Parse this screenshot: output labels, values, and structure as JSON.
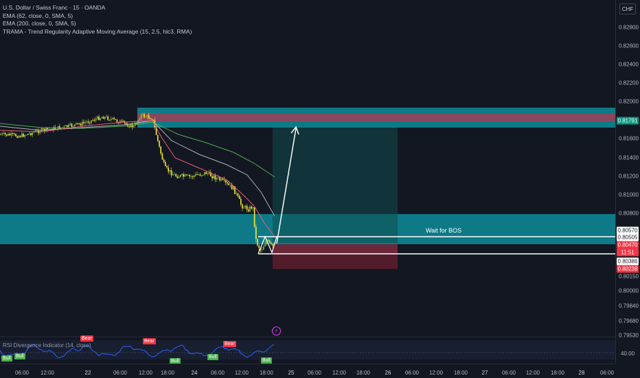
{
  "header": {
    "symbol_line": "U.S. Dollar / Swiss Franc · 15 · OANDA",
    "indicators": [
      "EMA (62, close, 0, SMA, 5)",
      "EMA (200, close, 0, SMA, 5)",
      "TRAMA - Trend Regularity Adaptive Moving Average (15, 2.5, hlc3, RMA)"
    ],
    "currency": "CHF"
  },
  "price_axis": {
    "ticks": [
      "0.82800",
      "0.82600",
      "0.82400",
      "0.82200",
      "0.82000",
      "0.81600",
      "0.81400",
      "0.81200",
      "0.81000",
      "0.80800",
      "0.80150",
      "0.80000",
      "0.79840",
      "0.79680",
      "0.79530"
    ],
    "labels": [
      {
        "text": "0.81791",
        "bg": "#089981",
        "fg": "#ffffff"
      },
      {
        "text": "0.80570",
        "bg": "#ffffff",
        "fg": "#131722"
      },
      {
        "text": "0.80505",
        "bg": "#ffffff",
        "fg": "#131722"
      },
      {
        "text": "0.80470",
        "bg": "#f23645",
        "fg": "#ffffff"
      },
      {
        "text": "11:51",
        "bg": "#f23645",
        "fg": "#ffffff"
      },
      {
        "text": "0.80386",
        "bg": "#ffffff",
        "fg": "#131722"
      },
      {
        "text": "0.80238",
        "bg": "#f23645",
        "fg": "#ffffff"
      }
    ]
  },
  "time_axis": [
    "06:00",
    "12:00",
    "22",
    "06:00",
    "12:00",
    "18:00",
    "24",
    "06:00",
    "12:00",
    "18:00",
    "25",
    "06:00",
    "12:00",
    "18:00",
    "26",
    "06:00",
    "12:00",
    "18:00",
    "27",
    "06:00",
    "12:00",
    "18:00",
    "28",
    "06:00",
    "12:00",
    "29",
    "06:00"
  ],
  "annotation": {
    "wait_text": "Wait for BOS"
  },
  "rsi_panel": {
    "title": "RSI Divergence Indicator (14, close)",
    "level": "40.00",
    "bull_label": "Bull",
    "bear_label": "Bear"
  },
  "colors": {
    "background": "#131722",
    "zone": "#0e8c99",
    "supply": "#9c3f56",
    "candle_up": "#8bc34a",
    "candle_down": "#ffeb3b",
    "ema62": "#f05b72",
    "ema200": "#4caf50",
    "trama": "#b0b3bd"
  },
  "icons": {
    "alert": "lightning-bolt-icon"
  }
}
